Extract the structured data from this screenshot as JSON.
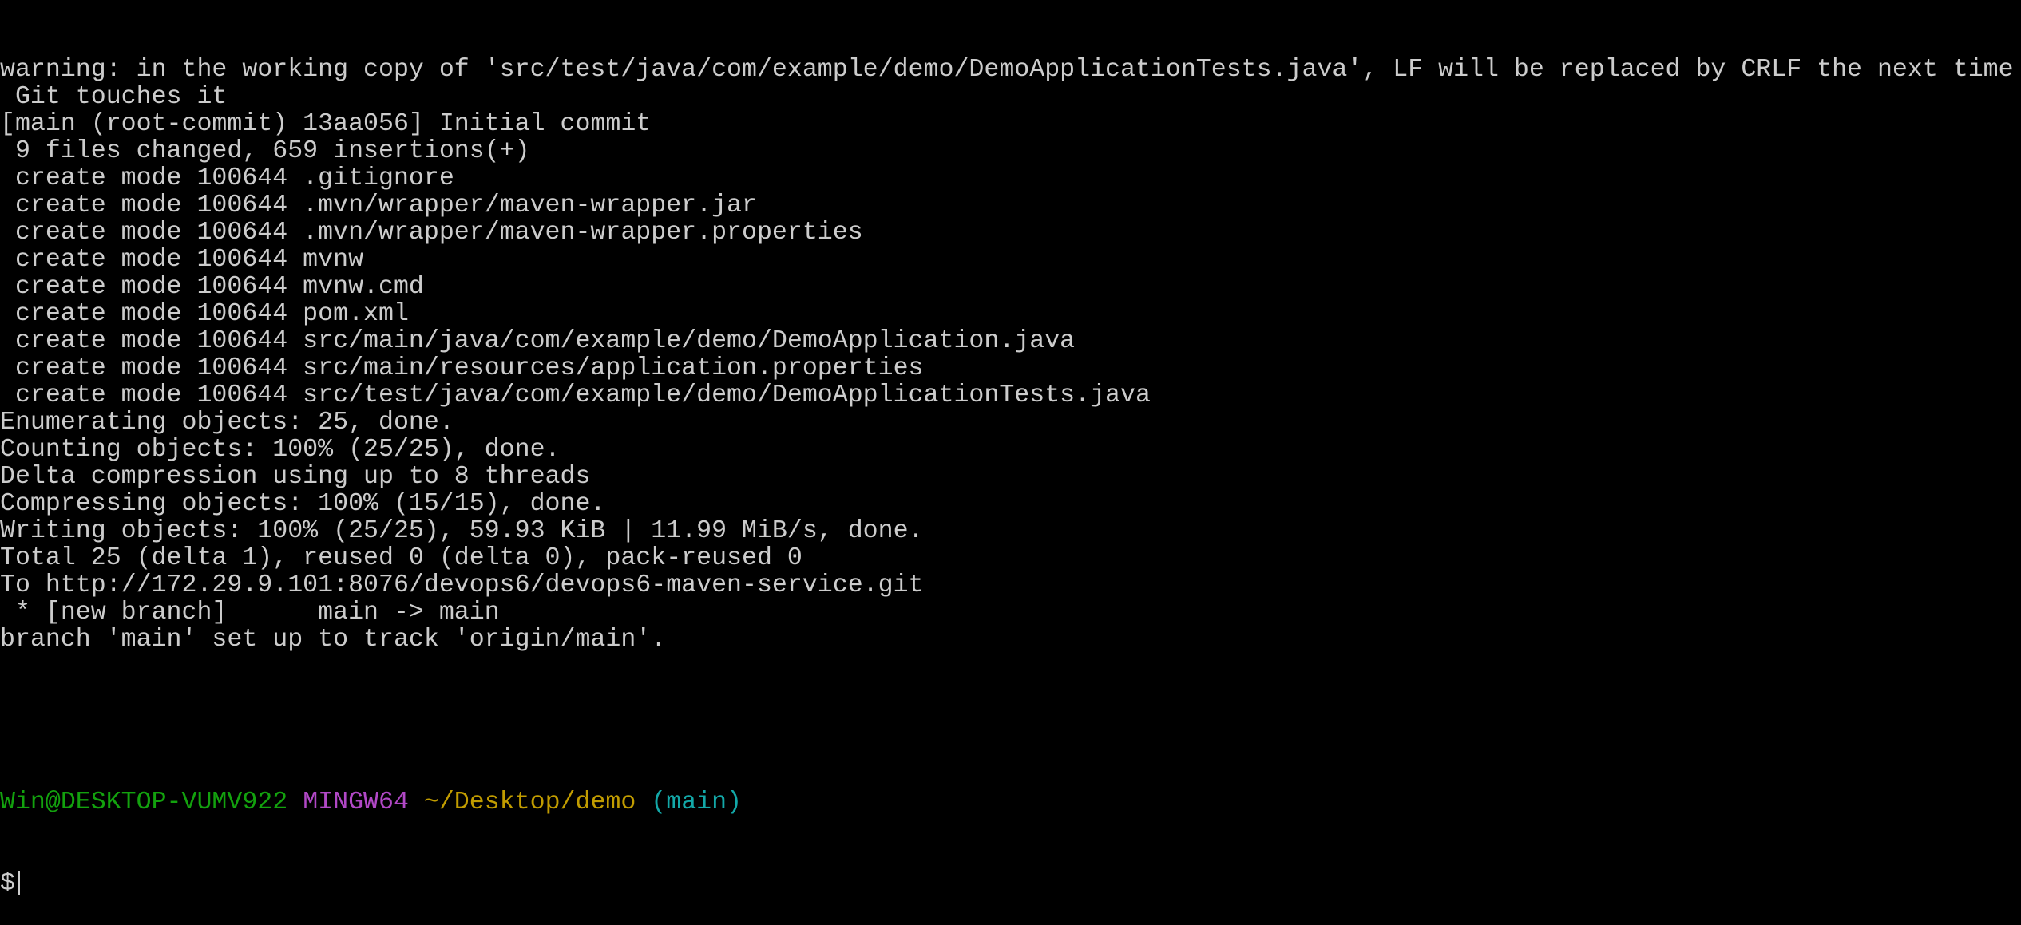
{
  "terminal": {
    "output_lines": [
      "warning: in the working copy of 'src/test/java/com/example/demo/DemoApplicationTests.java', LF will be replaced by CRLF the next time",
      " Git touches it",
      "[main (root-commit) 13aa056] Initial commit",
      " 9 files changed, 659 insertions(+)",
      " create mode 100644 .gitignore",
      " create mode 100644 .mvn/wrapper/maven-wrapper.jar",
      " create mode 100644 .mvn/wrapper/maven-wrapper.properties",
      " create mode 100644 mvnw",
      " create mode 100644 mvnw.cmd",
      " create mode 100644 pom.xml",
      " create mode 100644 src/main/java/com/example/demo/DemoApplication.java",
      " create mode 100644 src/main/resources/application.properties",
      " create mode 100644 src/test/java/com/example/demo/DemoApplicationTests.java",
      "Enumerating objects: 25, done.",
      "Counting objects: 100% (25/25), done.",
      "Delta compression using up to 8 threads",
      "Compressing objects: 100% (15/15), done.",
      "Writing objects: 100% (25/25), 59.93 KiB | 11.99 MiB/s, done.",
      "Total 25 (delta 1), reused 0 (delta 0), pack-reused 0",
      "To http://172.29.9.101:8076/devops6/devops6-maven-service.git",
      " * [new branch]      main -> main",
      "branch 'main' set up to track 'origin/main'."
    ],
    "prompt": {
      "user_host": "Win@DESKTOP-VUMV922",
      "system": "MINGW64",
      "path": "~/Desktop/demo",
      "branch": "(main)",
      "symbol": "$"
    },
    "colors": {
      "background": "#000000",
      "text": "#cccccc",
      "user_host": "#13a10e",
      "system": "#b148c6",
      "path": "#c19c00",
      "branch": "#13a8a8"
    }
  }
}
